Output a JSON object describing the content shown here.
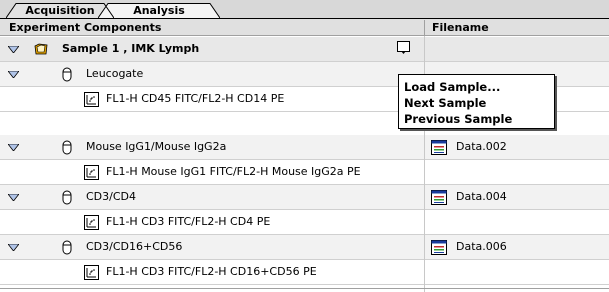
{
  "tabs": [
    {
      "label": "Acquisition",
      "active": false
    },
    {
      "label": "Analysis",
      "active": true
    }
  ],
  "columns": {
    "components": "Experiment Components",
    "filename": "Filename"
  },
  "sample": {
    "label": "Sample 1 , IMK Lymph",
    "icon": "sample-folder-icon"
  },
  "tubes": [
    {
      "label": "Leucogate",
      "file": "",
      "plot": "FL1-H CD45 FITC/FL2-H CD14 PE"
    },
    {
      "label": "Mouse IgG1/Mouse IgG2a",
      "file": "Data.002",
      "plot": "FL1-H Mouse IgG1 FITC/FL2-H Mouse IgG2a PE"
    },
    {
      "label": "CD3/CD4",
      "file": "Data.004",
      "plot": "FL1-H CD3 FITC/FL2-H CD4 PE"
    },
    {
      "label": "CD3/CD16+CD56",
      "file": "Data.006",
      "plot": "FL1-H CD3 FITC/FL2-H CD16+CD56 PE"
    }
  ],
  "menu": {
    "items": [
      "Load Sample...",
      "Next Sample",
      "Previous Sample"
    ]
  },
  "colors": {
    "accent_file_icon": "#1a3c9c",
    "folder": "#e0a000"
  }
}
